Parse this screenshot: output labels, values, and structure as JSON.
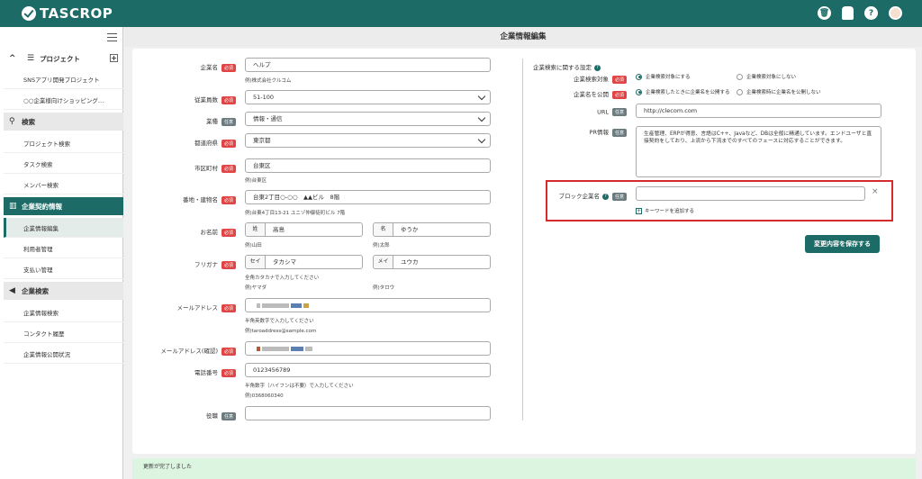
{
  "app": {
    "name": "TASCROP"
  },
  "sidebar": {
    "project_group": "プロジェクト",
    "projects": [
      "SNSアプリ開発プロジェクト",
      "○○企業様向けショッピング…"
    ],
    "search_group": "検索",
    "search_items": [
      "プロジェクト検索",
      "タスク検索",
      "メンバー検索"
    ],
    "contract_group": "企業契約情報",
    "contract_items": [
      "企業情報編集",
      "利用者管理",
      "支払い管理"
    ],
    "company_search_group": "企業検索",
    "company_search_items": [
      "企業情報検索",
      "コンタクト履歴",
      "企業情報公開状況"
    ]
  },
  "page": {
    "title": "企業情報編集"
  },
  "tags": {
    "required": "必須",
    "optional": "任意"
  },
  "form": {
    "company_name": {
      "label": "企業名",
      "value": "ヘルプ",
      "hint": "例)株式会社クルコム"
    },
    "employees": {
      "label": "従業員数",
      "value": "51-100"
    },
    "industry": {
      "label": "業種",
      "value": "情報・通信"
    },
    "prefecture": {
      "label": "都道府県",
      "value": "東京都"
    },
    "city": {
      "label": "市区町村",
      "value": "台東区",
      "hint": "例)台東区"
    },
    "address": {
      "label": "番地・建物名",
      "value": "台東2丁目○-○○　▲▲ビル　8階",
      "hint": "例)台東4丁目13-21 ユニゾ仲御徒町ビル 7階"
    },
    "name": {
      "label": "お名前",
      "last_prefix": "姓",
      "last_value": "高島",
      "last_hint": "例)山田",
      "first_prefix": "名",
      "first_value": "ゆうか",
      "first_hint": "例)太郎"
    },
    "furigana": {
      "label": "フリガナ",
      "last_prefix": "セイ",
      "last_value": "タカシマ",
      "first_prefix": "メイ",
      "first_value": "ユウカ",
      "hint": "全角カタカナで入力してください",
      "last_hint": "例)ヤマダ",
      "first_hint": "例)タロウ"
    },
    "email": {
      "label": "メールアドレス",
      "hint1": "半角英数字で入力してください",
      "hint2": "例)taroaddress@sample.com"
    },
    "email_confirm": {
      "label": "メールアドレス(確認)"
    },
    "phone": {
      "label": "電話番号",
      "value": "0123456789",
      "hint1": "半角数字（ハイフンは不要）で入力してください",
      "hint2": "例)0368060340"
    },
    "position": {
      "label": "役職"
    }
  },
  "search_settings": {
    "title": "企業検索に関する設定",
    "target": {
      "label": "企業検索対象",
      "option_on": "企業検索対象にする",
      "option_off": "企業検索対象にしない"
    },
    "publish": {
      "label": "企業名を公開",
      "option_on": "企業検索したときに企業名を公開する",
      "option_off": "企業検索時に企業名を公開しない"
    },
    "url": {
      "label": "URL",
      "value": "http://clecom.com"
    },
    "pr": {
      "label": "PR情報",
      "value": "生産管理、ERPが得意、言語はC++、Javaなど、DBは全般に精通しています。エンドユーザと直接契約をしており、上流から下流までのすべてのフェースに対応することができます。"
    },
    "block": {
      "label": "ブロック企業名",
      "add_label": "キーワードを追加する",
      "clear": "×"
    }
  },
  "save_button": "変更内容を保存する",
  "toast": "更新が完了しました",
  "icons": {
    "help": "?",
    "trash": "🗑",
    "close": "×",
    "plus": "+"
  },
  "colors": {
    "brand": "#1d6b66",
    "required": "#e04444",
    "highlight": "#d42c2c"
  }
}
